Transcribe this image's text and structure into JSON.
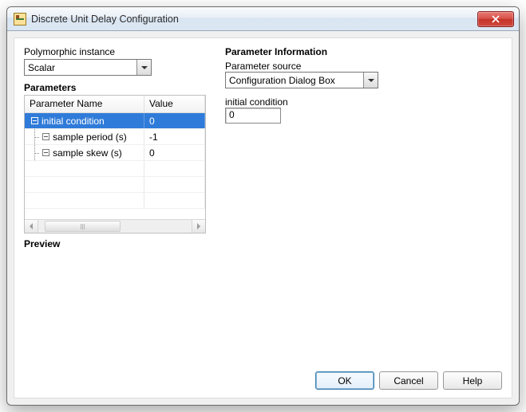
{
  "window": {
    "title": "Discrete Unit Delay Configuration"
  },
  "left": {
    "poly_label": "Polymorphic instance",
    "poly_value": "Scalar",
    "params_header": "Parameters",
    "col_name": "Parameter Name",
    "col_value": "Value",
    "rows": [
      {
        "name": "initial condition",
        "value": "0",
        "selected": true
      },
      {
        "name": "sample period (s)",
        "value": "-1",
        "selected": false
      },
      {
        "name": "sample skew (s)",
        "value": "0",
        "selected": false
      }
    ],
    "preview_header": "Preview"
  },
  "right": {
    "group_header": "Parameter Information",
    "source_label": "Parameter source",
    "source_value": "Configuration Dialog Box",
    "param_label": "initial condition",
    "param_value": "0"
  },
  "buttons": {
    "ok": "OK",
    "cancel": "Cancel",
    "help": "Help"
  }
}
